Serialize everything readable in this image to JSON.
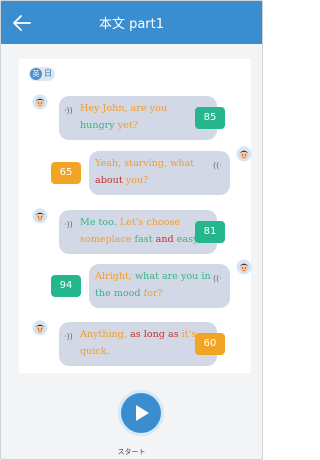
{
  "header": {
    "title": "本文 part1"
  },
  "lang_badge": {
    "icon": "英",
    "label": "日"
  },
  "messages": [
    {
      "side": "left",
      "score": "85",
      "score_color": "#26b68e",
      "lines": [
        [
          {
            "t": "Hey John, are you",
            "c": "or"
          }
        ],
        [
          {
            "t": "hungry",
            "c": "gr"
          },
          {
            "t": " yet?",
            "c": "or"
          }
        ]
      ]
    },
    {
      "side": "right",
      "score": "65",
      "score_color": "#f2a524",
      "lines": [
        [
          {
            "t": "Yeah, starving, what",
            "c": "or"
          }
        ],
        [
          {
            "t": "about",
            "c": "rd"
          },
          {
            "t": " you?",
            "c": "or"
          }
        ]
      ]
    },
    {
      "side": "left",
      "score": "81",
      "score_color": "#26b68e",
      "lines": [
        [
          {
            "t": "Me too. ",
            "c": "gr"
          },
          {
            "t": "Let's choose",
            "c": "or"
          }
        ],
        [
          {
            "t": "someplace",
            "c": "or"
          },
          {
            "t": " fast",
            "c": "gr"
          },
          {
            "t": " and",
            "c": "rd"
          },
          {
            "t": " easy.",
            "c": "gr"
          }
        ]
      ]
    },
    {
      "side": "right",
      "score": "94",
      "score_color": "#26b68e",
      "lines": [
        [
          {
            "t": "Alright,",
            "c": "or"
          },
          {
            "t": " what are you in",
            "c": "gr"
          }
        ],
        [
          {
            "t": "the mood",
            "c": "gr"
          },
          {
            "t": " for?",
            "c": "or"
          }
        ]
      ]
    },
    {
      "side": "left",
      "score": "60",
      "score_color": "#f2a524",
      "lines": [
        [
          {
            "t": "Anything, ",
            "c": "or"
          },
          {
            "t": "as long as",
            "c": "rd"
          },
          {
            "t": " it's",
            "c": "or"
          }
        ],
        [
          {
            "t": "quick.",
            "c": "or"
          }
        ]
      ]
    }
  ],
  "start": {
    "label": "スタート"
  }
}
